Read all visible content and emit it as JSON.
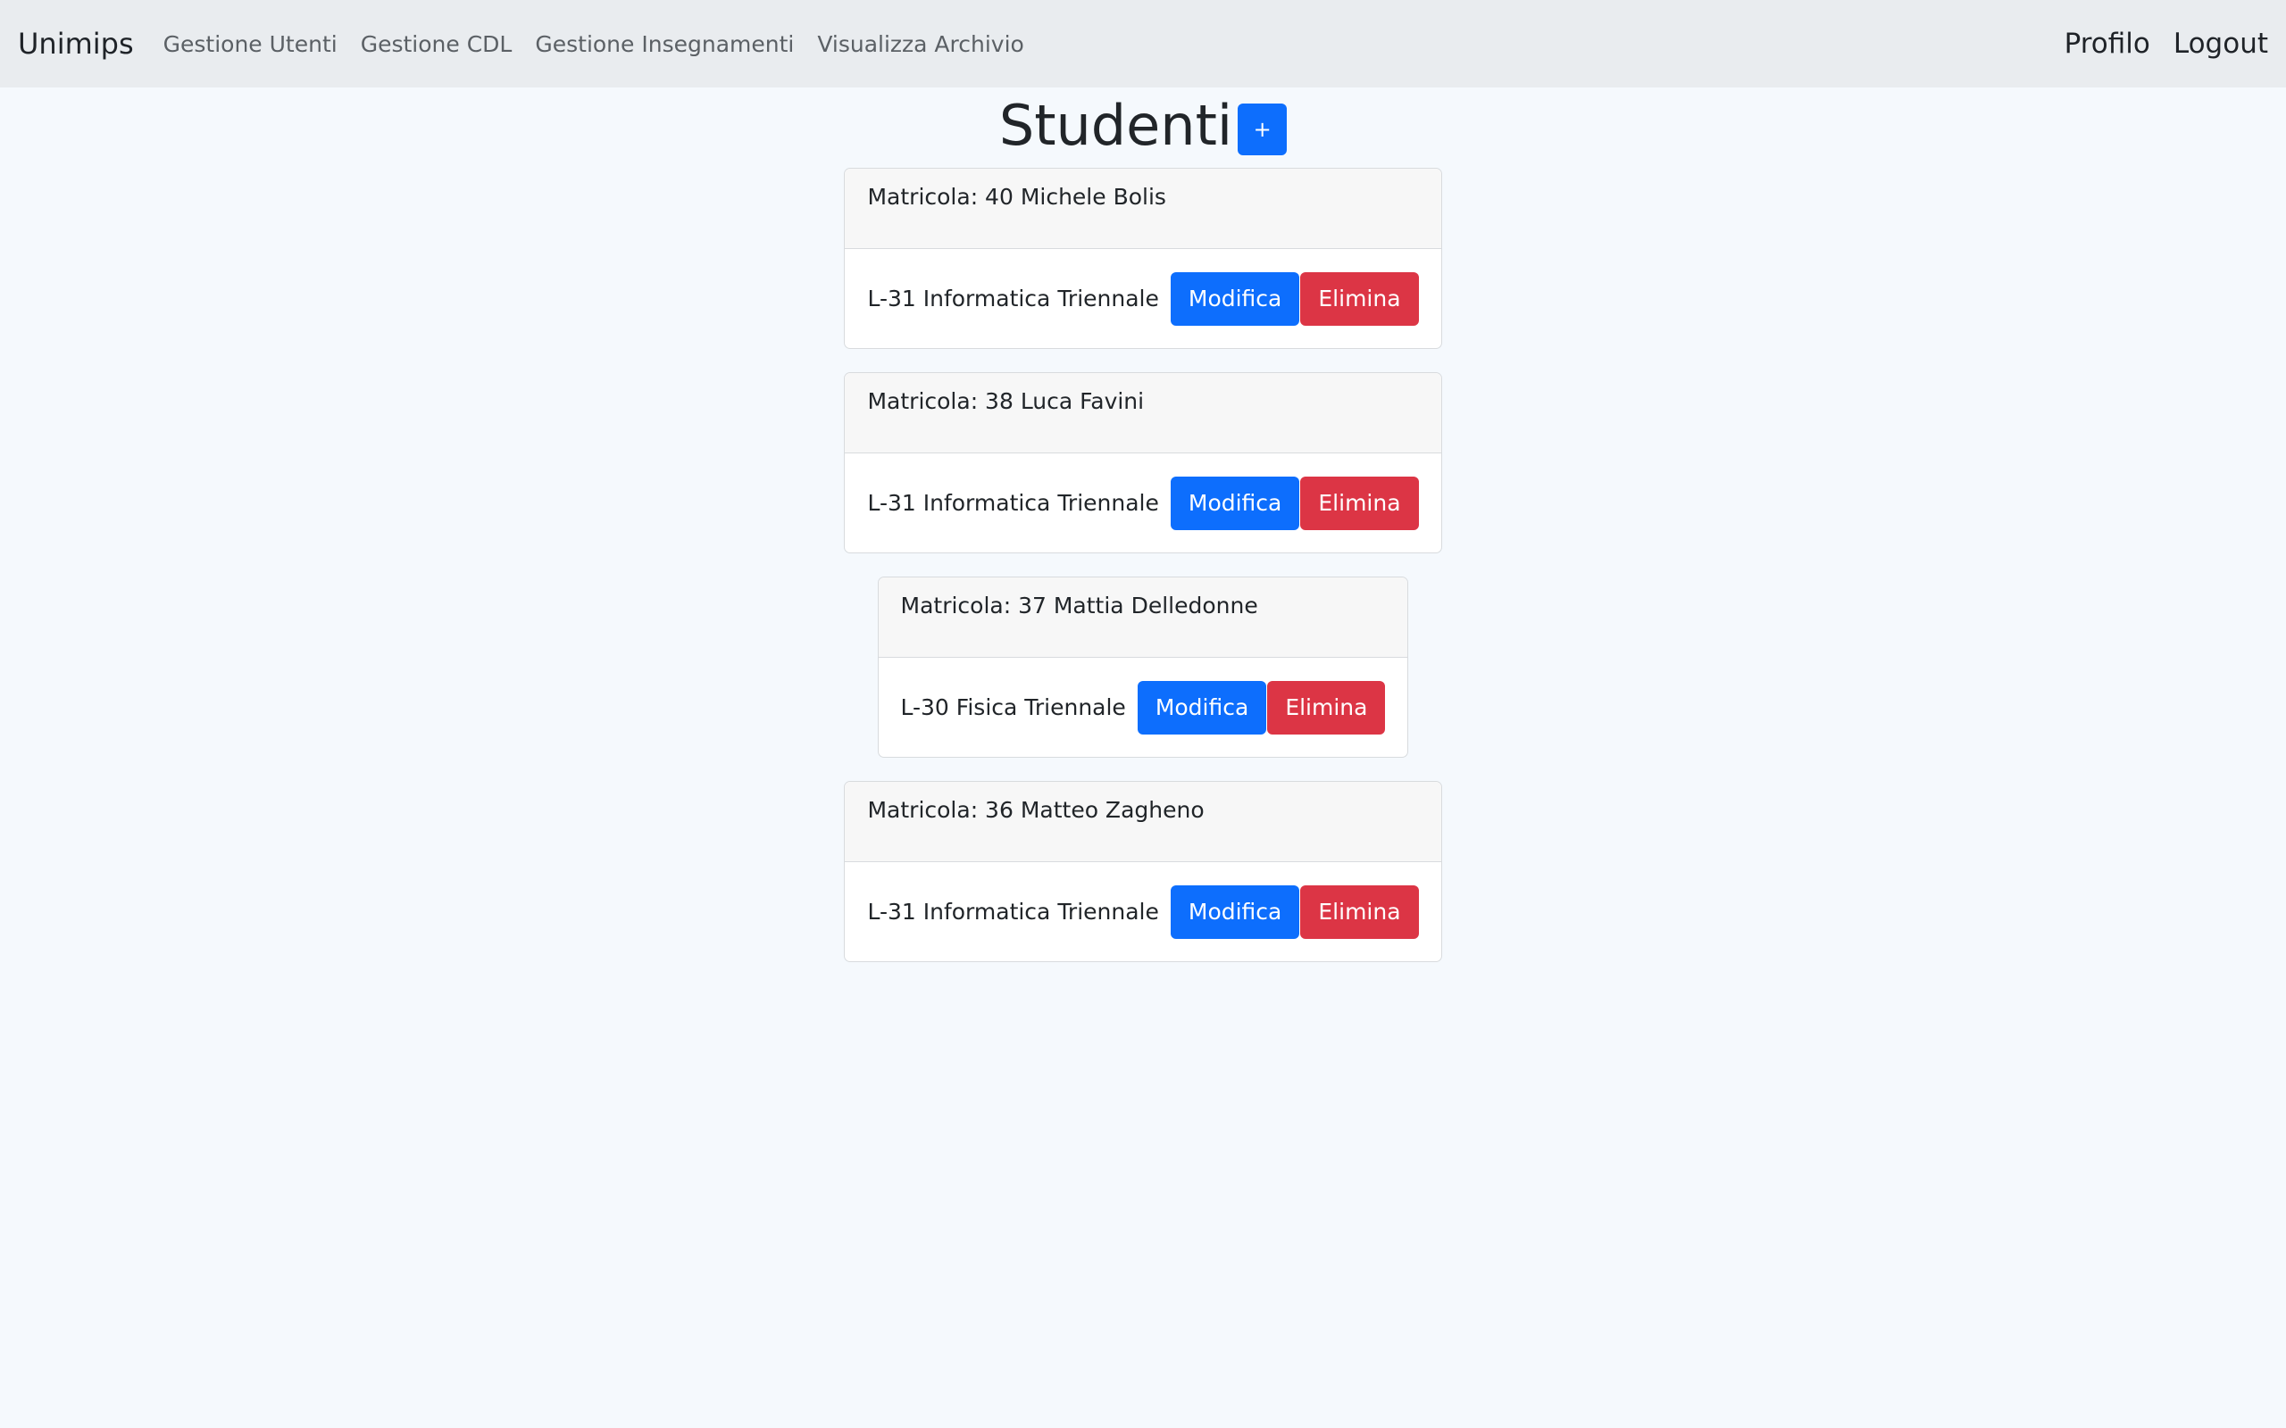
{
  "navbar": {
    "brand": "Unimips",
    "links": [
      {
        "label": "Gestione Utenti"
      },
      {
        "label": "Gestione CDL"
      },
      {
        "label": "Gestione Insegnamenti"
      },
      {
        "label": "Visualizza Archivio"
      }
    ],
    "profile_label": "Profilo",
    "logout_label": "Logout"
  },
  "page": {
    "title": "Studenti",
    "add_label": "+"
  },
  "students": [
    {
      "header": "Matricola: 40 Michele Bolis",
      "course": "L-31 Informatica Triennale",
      "edit_label": "Modifica",
      "delete_label": "Elimina"
    },
    {
      "header": "Matricola: 38 Luca Favini",
      "course": "L-31 Informatica Triennale",
      "edit_label": "Modifica",
      "delete_label": "Elimina"
    },
    {
      "header": "Matricola: 37 Mattia Delledonne",
      "course": "L-30 Fisica Triennale",
      "edit_label": "Modifica",
      "delete_label": "Elimina"
    },
    {
      "header": "Matricola: 36 Matteo Zagheno",
      "course": "L-31 Informatica Triennale",
      "edit_label": "Modifica",
      "delete_label": "Elimina"
    }
  ],
  "colors": {
    "primary": "#0d6efd",
    "danger": "#dc3545",
    "navbar_bg": "#e9ecef",
    "page_bg": "#f5f9fd"
  }
}
